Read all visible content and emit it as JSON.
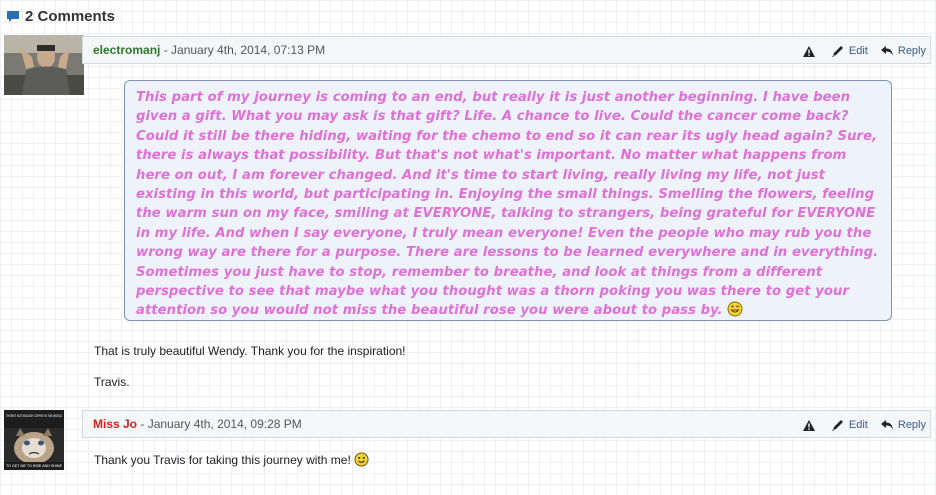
{
  "heading": {
    "title": "2 Comments"
  },
  "comments": [
    {
      "author": "electromanj",
      "date": "January 4th, 2014, 07:13 PM",
      "separator": " - ",
      "actions": {
        "edit": "Edit",
        "reply": "Reply"
      },
      "quote": "This part of my journey is coming to an end, but really it is just another beginning. I have been given a gift. What you may ask is that gift? Life. A chance to live. Could the cancer come back? Could it still be there hiding, waiting for the chemo to end so it can rear its ugly head again? Sure, there is always that possibility. But that's not what's important. No matter what happens from here on out, I am forever changed. And it's time to start living, really living my life, not just existing in this world, but participating in. Enjoying the small things. Smelling the flowers, feeling the warm sun on my face, smiling at EVERYONE, talking to strangers, being grateful for EVERYONE in my life. And when I say everyone, I truly mean everyone! Even the people who may rub you the wrong way are there for a purpose. There are lessons to be learned everywhere and in everything. Sometimes you just have to stop, remember to breathe, and look at things from a different perspective to see that maybe what you thought was a thorn poking you was there to get your attention so you would not miss the beautiful rose you were about to pass by.",
      "body_line1": "That is truly beautiful Wendy. Thank you for the inspiration!",
      "body_line2": "Travis."
    },
    {
      "author": "Miss Jo",
      "date": "January 4th, 2014, 09:28 PM",
      "separator": " - ",
      "actions": {
        "edit": "Edit",
        "reply": "Reply"
      },
      "avatar_text_top": "THERE'S NOT ENOUGH COFFEE IN THE WORLD",
      "avatar_text_bottom": "TO GET ME TO RISE AND SHINE",
      "body_line1": "Thank you Travis for taking this journey with me!"
    }
  ],
  "colors": {
    "quote_text": "#e070d6",
    "author1": "#2b7a2b",
    "author2": "#d42020",
    "bubble_bg": "#edf2fb",
    "bubble_border": "#7f93b3"
  },
  "icons": [
    "comment-icon",
    "warning-icon",
    "pencil-icon",
    "reply-arrow-icon",
    "smiley-icon"
  ]
}
